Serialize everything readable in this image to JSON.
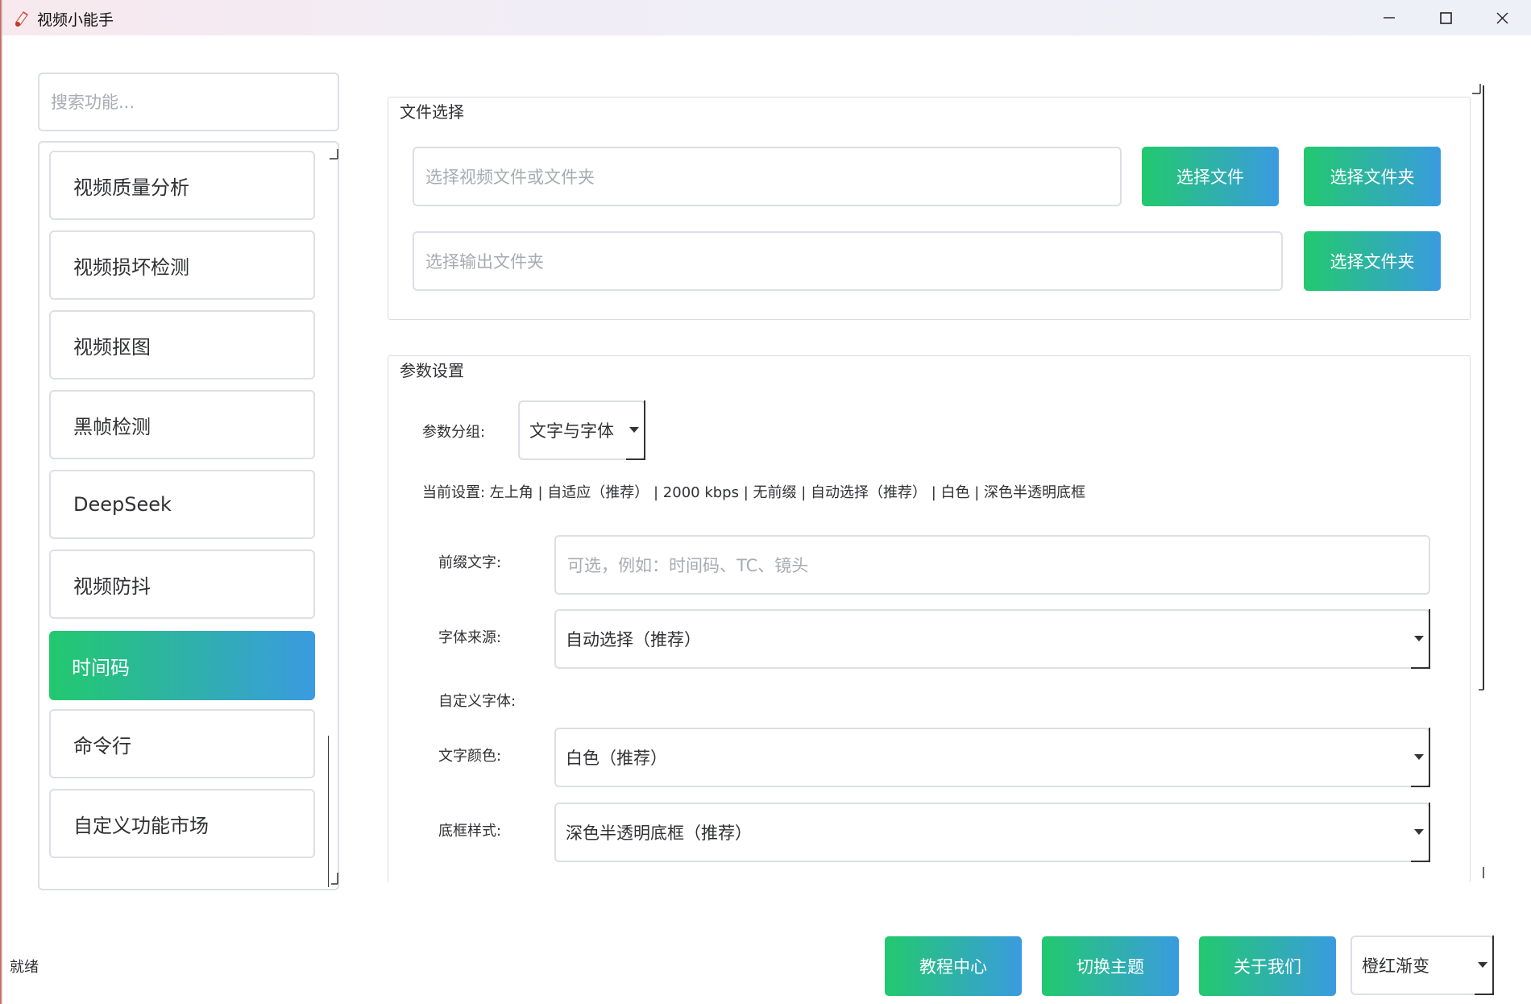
{
  "window": {
    "title": "视频小能手",
    "controls": [
      "minimize-icon",
      "maximize-icon",
      "close-icon"
    ]
  },
  "sidebar": {
    "search_placeholder": "搜索功能...",
    "items": [
      {
        "label": "视频质量分析",
        "active": false
      },
      {
        "label": "视频损坏检测",
        "active": false
      },
      {
        "label": "视频抠图",
        "active": false
      },
      {
        "label": "黑帧检测",
        "active": false
      },
      {
        "label": "DeepSeek",
        "active": false
      },
      {
        "label": "视频防抖",
        "active": false
      },
      {
        "label": "时间码",
        "active": true
      },
      {
        "label": "命令行",
        "active": false
      },
      {
        "label": "自定义功能市场",
        "active": false
      }
    ]
  },
  "file_select": {
    "title": "文件选择",
    "input_placeholder": "选择视频文件或文件夹",
    "select_file_label": "选择文件",
    "select_folder_label": "选择文件夹",
    "output_placeholder": "选择输出文件夹",
    "output_folder_label": "选择文件夹"
  },
  "params": {
    "title": "参数设置",
    "group_label": "参数分组:",
    "group_value": "文字与字体",
    "current_settings": "当前设置: 左上角 | 自适应（推荐） | 2000 kbps | 无前缀 | 自动选择（推荐） | 白色 | 深色半透明底框",
    "prefix_label": "前缀文字:",
    "prefix_placeholder": "可选，例如：时间码、TC、镜头",
    "font_source_label": "字体来源:",
    "font_source_value": "自动选择（推荐）",
    "custom_font_label": "自定义字体:",
    "text_color_label": "文字颜色:",
    "text_color_value": "白色（推荐）",
    "box_style_label": "底框样式:",
    "box_style_value": "深色半透明底框（推荐）"
  },
  "footer": {
    "status": "就绪",
    "tutorial_label": "教程中心",
    "switch_theme_label": "切换主题",
    "about_label": "关于我们",
    "theme_value": "橙红渐变"
  },
  "colors": {
    "accent_start": "#22c96e",
    "accent_end": "#3a9be0"
  }
}
